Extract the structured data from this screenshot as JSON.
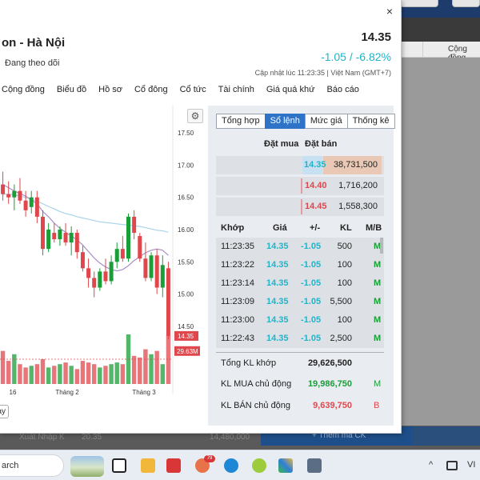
{
  "background": {
    "column_header": "Cộng đồng",
    "partial_row": "Xuất Nhập K",
    "partial_values": [
      "20.35",
      "14,480,000"
    ],
    "add_button": "+ Thêm mã CK"
  },
  "dialog": {
    "close_icon": "×",
    "title": "on - Hà Nội",
    "follow_label": "Đang theo dõi",
    "price": "14.35",
    "change": "-1.05 / -6.82%",
    "update_text": "Cập nhật lúc  11:23:35 | Việt Nam (GMT+7)",
    "tabs": [
      "Cộng đồng",
      "Biểu đồ",
      "Hồ sơ",
      "Cổ đông",
      "Cổ tức",
      "Tài chính",
      "Giá quá khứ",
      "Báo cáo"
    ],
    "range_button": "ày",
    "gear_icon": "⚙"
  },
  "colors": {
    "up": "#1a9e38",
    "down": "#e0474c",
    "ref_cyan": "#1fb4c8",
    "active_tab": "#2f73c8"
  },
  "chart_data": {
    "type": "candlestick",
    "y_ticks": [
      "17.50",
      "17.00",
      "16.50",
      "16.00",
      "15.50",
      "15.00",
      "14.50"
    ],
    "y_range": [
      14.2,
      17.8
    ],
    "x_labels": [
      "16",
      "Tháng 2",
      "Tháng 3"
    ],
    "last_price_label": "14.35",
    "volume_label": "29.63M",
    "candles": [
      {
        "o": 16.7,
        "h": 16.9,
        "l": 16.45,
        "c": 16.55
      },
      {
        "o": 16.55,
        "h": 16.75,
        "l": 16.4,
        "c": 16.5
      },
      {
        "o": 16.5,
        "h": 16.7,
        "l": 16.3,
        "c": 16.6
      },
      {
        "o": 16.6,
        "h": 16.8,
        "l": 16.4,
        "c": 16.45
      },
      {
        "o": 16.45,
        "h": 16.6,
        "l": 16.2,
        "c": 16.3
      },
      {
        "o": 16.35,
        "h": 16.6,
        "l": 16.25,
        "c": 16.5
      },
      {
        "o": 16.5,
        "h": 16.6,
        "l": 16.1,
        "c": 16.2
      },
      {
        "o": 16.2,
        "h": 16.3,
        "l": 15.6,
        "c": 15.7
      },
      {
        "o": 15.7,
        "h": 16.1,
        "l": 15.65,
        "c": 16.0
      },
      {
        "o": 15.95,
        "h": 16.1,
        "l": 15.8,
        "c": 15.85
      },
      {
        "o": 15.85,
        "h": 16.05,
        "l": 15.75,
        "c": 16.0
      },
      {
        "o": 15.95,
        "h": 16.1,
        "l": 15.75,
        "c": 15.8
      },
      {
        "o": 15.8,
        "h": 16.05,
        "l": 15.6,
        "c": 15.95
      },
      {
        "o": 15.95,
        "h": 16.0,
        "l": 15.55,
        "c": 15.65
      },
      {
        "o": 15.65,
        "h": 15.75,
        "l": 15.35,
        "c": 15.4
      },
      {
        "o": 15.4,
        "h": 15.55,
        "l": 15.1,
        "c": 15.25
      },
      {
        "o": 15.25,
        "h": 15.35,
        "l": 14.95,
        "c": 15.1
      },
      {
        "o": 15.1,
        "h": 15.4,
        "l": 15.05,
        "c": 15.35
      },
      {
        "o": 15.35,
        "h": 15.55,
        "l": 15.15,
        "c": 15.2
      },
      {
        "o": 15.2,
        "h": 15.6,
        "l": 15.15,
        "c": 15.5
      },
      {
        "o": 15.5,
        "h": 15.8,
        "l": 15.4,
        "c": 15.7
      },
      {
        "o": 15.7,
        "h": 15.9,
        "l": 15.5,
        "c": 15.55
      },
      {
        "o": 15.55,
        "h": 16.25,
        "l": 15.5,
        "c": 16.2
      },
      {
        "o": 16.2,
        "h": 16.3,
        "l": 15.85,
        "c": 15.95
      },
      {
        "o": 15.9,
        "h": 15.95,
        "l": 15.5,
        "c": 15.55
      },
      {
        "o": 15.55,
        "h": 15.8,
        "l": 15.2,
        "c": 15.25
      },
      {
        "o": 15.25,
        "h": 15.65,
        "l": 15.2,
        "c": 15.6
      },
      {
        "o": 15.6,
        "h": 15.7,
        "l": 15.0,
        "c": 15.1
      },
      {
        "o": 15.1,
        "h": 15.6,
        "l": 14.95,
        "c": 15.45
      },
      {
        "o": 15.4,
        "h": 15.5,
        "l": 14.3,
        "c": 14.35
      }
    ],
    "ma_slow": [
      16.55,
      16.55,
      16.54,
      16.52,
      16.5,
      16.47,
      16.44,
      16.4,
      16.36,
      16.32,
      16.28,
      16.25,
      16.23,
      16.2,
      16.18,
      16.16,
      16.14,
      16.12,
      16.11,
      16.1,
      16.09,
      16.08,
      16.07,
      16.06,
      16.05,
      16.03,
      16.01,
      15.99,
      15.98,
      15.96
    ],
    "ma_fast": [
      16.7,
      16.65,
      16.6,
      16.56,
      16.52,
      16.46,
      16.4,
      16.28,
      16.2,
      16.1,
      16.02,
      15.96,
      15.9,
      15.84,
      15.76,
      15.66,
      15.56,
      15.48,
      15.42,
      15.38,
      15.36,
      15.38,
      15.44,
      15.52,
      15.58,
      15.64,
      15.68,
      15.7,
      15.68,
      15.6
    ],
    "volume_range": [
      0,
      45
    ],
    "volumes": [
      20,
      14,
      18,
      12,
      10,
      11,
      12,
      15,
      10,
      11,
      12,
      13,
      11,
      9,
      14,
      13,
      12,
      10,
      11,
      12,
      13,
      12,
      30,
      17,
      16,
      21,
      18,
      20,
      12,
      29.63
    ],
    "volume_ref": 15
  },
  "order_book": {
    "tabs": [
      "Tổng hợp",
      "Sổ lệnh",
      "Mức giá",
      "Thống kê"
    ],
    "active_tab": 1,
    "bid_header": "Đặt mua",
    "ask_header": "Đặt bán",
    "rows": [
      {
        "price": "14.35",
        "volume": "38,731,500",
        "price_color": "#1fb4c8"
      },
      {
        "price": "14.40",
        "volume": "1,716,200",
        "price_color": "#e0474c"
      },
      {
        "price": "14.45",
        "volume": "1,558,300",
        "price_color": "#e0474c"
      }
    ],
    "match_headers": [
      "Khớp",
      "Giá",
      "+/-",
      "KL",
      "M/B"
    ],
    "matches": [
      {
        "time": "11:23:35",
        "price": "14.35",
        "change": "-1.05",
        "volume": "500",
        "side": "M"
      },
      {
        "time": "11:23:22",
        "price": "14.35",
        "change": "-1.05",
        "volume": "100",
        "side": "M"
      },
      {
        "time": "11:23:14",
        "price": "14.35",
        "change": "-1.05",
        "volume": "100",
        "side": "M"
      },
      {
        "time": "11:23:09",
        "price": "14.35",
        "change": "-1.05",
        "volume": "5,500",
        "side": "M"
      },
      {
        "time": "11:23:00",
        "price": "14.35",
        "change": "-1.05",
        "volume": "100",
        "side": "M"
      },
      {
        "time": "11:22:43",
        "price": "14.35",
        "change": "-1.05",
        "volume": "2,500",
        "side": "M"
      }
    ],
    "totals": [
      {
        "label": "Tổng KL khớp",
        "value": "29,626,500",
        "value_color": "#222222",
        "tag": "",
        "tag_color": "#222222"
      },
      {
        "label": "KL MUA chủ động",
        "value": "19,986,750",
        "value_color": "#1a9e38",
        "tag": "M",
        "tag_color": "#1a9e38"
      },
      {
        "label": "KL BÁN chủ động",
        "value": "9,639,750",
        "value_color": "#e0474c",
        "tag": "B",
        "tag_color": "#e0474c"
      }
    ]
  },
  "taskbar": {
    "search_text": "arch",
    "badge": "79",
    "tray_caret": "^",
    "tray_lang": "VI"
  }
}
